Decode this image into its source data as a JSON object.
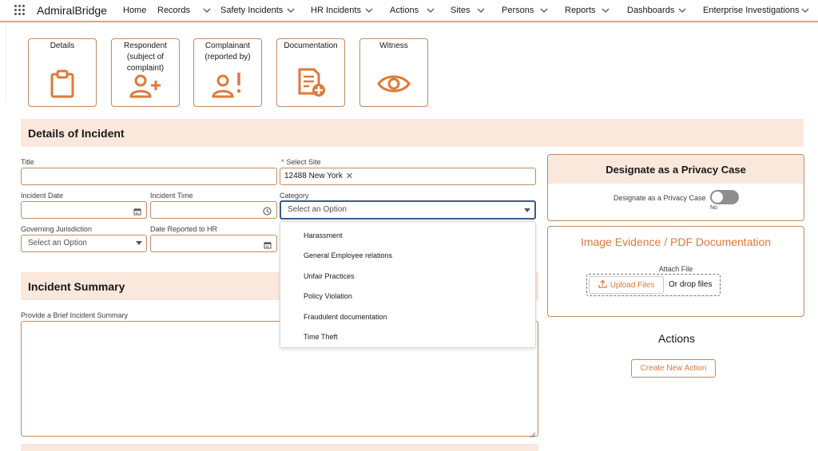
{
  "app": {
    "name": "AdmiralBridge"
  },
  "nav": {
    "items": [
      {
        "label": "Home"
      },
      {
        "label": "Records"
      },
      {
        "label": "Safety Incidents"
      },
      {
        "label": "HR Incidents"
      },
      {
        "label": "Actions"
      },
      {
        "label": "Sites"
      },
      {
        "label": "Persons"
      },
      {
        "label": "Reports"
      },
      {
        "label": "Dashboards"
      },
      {
        "label": "Enterprise Investigations"
      }
    ]
  },
  "tiles": [
    {
      "label": "Details",
      "icon": "clipboard-icon"
    },
    {
      "label": "Respondent (subject of complaint)",
      "icon": "person-add-icon"
    },
    {
      "label": "Complainant (reported by)",
      "icon": "person-alert-icon"
    },
    {
      "label": "Documentation",
      "icon": "document-add-icon"
    },
    {
      "label": "Witness",
      "icon": "eye-icon"
    }
  ],
  "details": {
    "section_title": "Details of Incident",
    "title_label": "Title",
    "title_value": "",
    "site_label": "Select Site",
    "site_value": "12488 New York",
    "incident_date_label": "Incident Date",
    "incident_time_label": "Incident Time",
    "category_label": "Category",
    "category_placeholder": "Select an Option",
    "jurisdiction_label": "Governing Jurisdiction",
    "jurisdiction_placeholder": "Select an Option",
    "date_reported_label": "Date Reported to HR"
  },
  "category_options": [
    "Harassment",
    "General Employee relations",
    "Unfair Practices",
    "Policy Violation",
    "Fraudulent documentation",
    "Time Theft"
  ],
  "summary": {
    "section_title": "Incident Summary",
    "field_label": "Provide a Brief Incident Summary",
    "value": ""
  },
  "privacy": {
    "title": "Designate as a Privacy Case",
    "toggle_label": "Designate as a Privacy Case",
    "toggle_state": "No"
  },
  "evidence": {
    "title": "Image Evidence / PDF Documentation",
    "attach_label": "Attach File",
    "upload_label": "Upload Files",
    "drop_label": "Or drop files"
  },
  "actions": {
    "title": "Actions",
    "create_label": "Create New Action"
  },
  "colors": {
    "accent": "#dd7a3a",
    "border": "#c08a64",
    "header_bg": "#fae8dc",
    "focus": "#3a5a8c"
  }
}
